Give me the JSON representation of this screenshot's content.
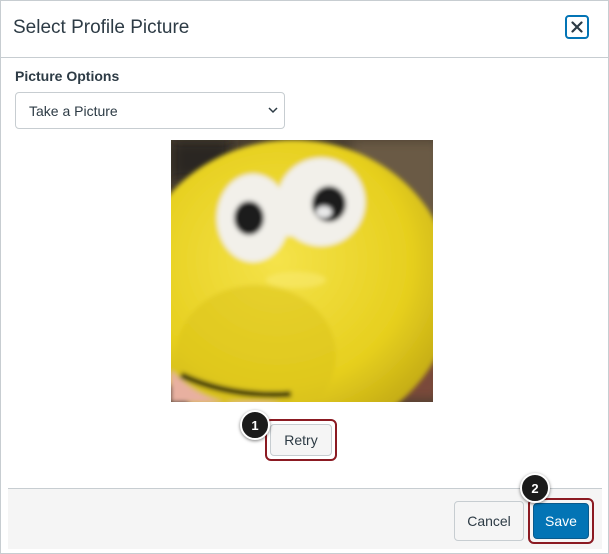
{
  "dialog": {
    "title": "Select Profile Picture",
    "close_icon": "close-icon"
  },
  "picture_options": {
    "label": "Picture Options",
    "selected": "Take a Picture",
    "dropdown_icon": "chevron-down-icon"
  },
  "preview": {
    "retry_label": "Retry",
    "callout_1": "1"
  },
  "footer": {
    "cancel_label": "Cancel",
    "save_label": "Save",
    "callout_2": "2"
  },
  "colors": {
    "accent": "#0374b5",
    "highlight_outline": "#8b1a22",
    "text": "#2d3b45",
    "border": "#c7cdd1"
  }
}
